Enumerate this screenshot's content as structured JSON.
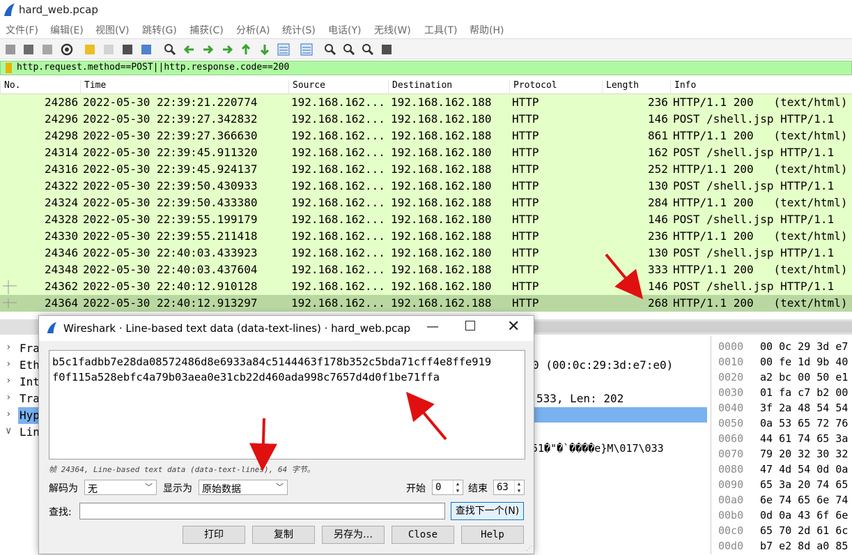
{
  "window": {
    "title": "hard_web.pcap"
  },
  "menu": [
    "文件(F)",
    "编辑(E)",
    "视图(V)",
    "跳转(G)",
    "捕获(C)",
    "分析(A)",
    "统计(S)",
    "电话(Y)",
    "无线(W)",
    "工具(T)",
    "帮助(H)"
  ],
  "toolbar_icons": [
    "start-capture-icon",
    "stop-capture-icon",
    "restart-capture-icon",
    "options-icon",
    "open-file-icon",
    "file-icon",
    "close-file-icon",
    "reload-icon",
    "find-packet-icon",
    "go-back-icon",
    "go-forward-icon",
    "go-to-packet-icon",
    "first-packet-icon",
    "last-packet-icon",
    "autoscroll-icon",
    "colorize-icon",
    "zoom-in-icon",
    "zoom-out-icon",
    "normal-size-icon",
    "resize-columns-icon"
  ],
  "filter": {
    "text": "http.request.method==POST||http.response.code==200"
  },
  "columns": [
    "No.",
    "Time",
    "Source",
    "Destination",
    "Protocol",
    "Length",
    "Info"
  ],
  "packets": [
    {
      "no": "24286",
      "time": "2022-05-30 22:39:21.220774",
      "src": "192.168.162...",
      "dst": "192.168.162.188",
      "proto": "HTTP",
      "len": "236",
      "info": "HTTP/1.1 200   (text/html)"
    },
    {
      "no": "24296",
      "time": "2022-05-30 22:39:27.342832",
      "src": "192.168.162...",
      "dst": "192.168.162.180",
      "proto": "HTTP",
      "len": "146",
      "info": "POST /shell.jsp HTTP/1.1"
    },
    {
      "no": "24298",
      "time": "2022-05-30 22:39:27.366630",
      "src": "192.168.162...",
      "dst": "192.168.162.188",
      "proto": "HTTP",
      "len": "861",
      "info": "HTTP/1.1 200   (text/html)"
    },
    {
      "no": "24314",
      "time": "2022-05-30 22:39:45.911320",
      "src": "192.168.162...",
      "dst": "192.168.162.180",
      "proto": "HTTP",
      "len": "162",
      "info": "POST /shell.jsp HTTP/1.1"
    },
    {
      "no": "24316",
      "time": "2022-05-30 22:39:45.924137",
      "src": "192.168.162...",
      "dst": "192.168.162.188",
      "proto": "HTTP",
      "len": "252",
      "info": "HTTP/1.1 200   (text/html)"
    },
    {
      "no": "24322",
      "time": "2022-05-30 22:39:50.430933",
      "src": "192.168.162...",
      "dst": "192.168.162.180",
      "proto": "HTTP",
      "len": "130",
      "info": "POST /shell.jsp HTTP/1.1"
    },
    {
      "no": "24324",
      "time": "2022-05-30 22:39:50.433380",
      "src": "192.168.162...",
      "dst": "192.168.162.188",
      "proto": "HTTP",
      "len": "284",
      "info": "HTTP/1.1 200   (text/html)"
    },
    {
      "no": "24328",
      "time": "2022-05-30 22:39:55.199179",
      "src": "192.168.162...",
      "dst": "192.168.162.180",
      "proto": "HTTP",
      "len": "146",
      "info": "POST /shell.jsp HTTP/1.1"
    },
    {
      "no": "24330",
      "time": "2022-05-30 22:39:55.211418",
      "src": "192.168.162...",
      "dst": "192.168.162.188",
      "proto": "HTTP",
      "len": "236",
      "info": "HTTP/1.1 200   (text/html)"
    },
    {
      "no": "24346",
      "time": "2022-05-30 22:40:03.433923",
      "src": "192.168.162...",
      "dst": "192.168.162.180",
      "proto": "HTTP",
      "len": "130",
      "info": "POST /shell.jsp HTTP/1.1"
    },
    {
      "no": "24348",
      "time": "2022-05-30 22:40:03.437604",
      "src": "192.168.162...",
      "dst": "192.168.162.188",
      "proto": "HTTP",
      "len": "333",
      "info": "HTTP/1.1 200   (text/html)"
    },
    {
      "no": "24362",
      "time": "2022-05-30 22:40:12.910128",
      "src": "192.168.162...",
      "dst": "192.168.162.180",
      "proto": "HTTP",
      "len": "146",
      "info": "POST /shell.jsp HTTP/1.1"
    },
    {
      "no": "24364",
      "time": "2022-05-30 22:40:12.913297",
      "src": "192.168.162...",
      "dst": "192.168.162.188",
      "proto": "HTTP",
      "len": "268",
      "info": "HTTP/1.1 200   (text/html)"
    }
  ],
  "detail": [
    {
      "text": "Fra",
      "expanded": false
    },
    {
      "text": "Eth",
      "expanded": false
    },
    {
      "text": "Int",
      "expanded": false
    },
    {
      "text": "Tra",
      "expanded": false
    },
    {
      "text": "Hyp",
      "expanded": false,
      "selected": true
    },
    {
      "text": "Lin",
      "expanded": true
    }
  ],
  "detail_visible": {
    "eth_tail": "0 (00:0c:29:3d:e7:e0)",
    "tcp_tail": "533, Len: 202",
    "line_tail": "51�\"�`����e}M\\017\\033"
  },
  "hex": [
    {
      "off": "0000",
      "bytes": "00 0c 29 3d e7"
    },
    {
      "off": "0010",
      "bytes": "00 fe 1d 9b 40"
    },
    {
      "off": "0020",
      "bytes": "a2 bc 00 50 e1"
    },
    {
      "off": "0030",
      "bytes": "01 fa c7 b2 00"
    },
    {
      "off": "0040",
      "bytes": "3f 2a 48 54 54"
    },
    {
      "off": "0050",
      "bytes": "0a 53 65 72 76"
    },
    {
      "off": "0060",
      "bytes": "44 61 74 65 3a"
    },
    {
      "off": "0070",
      "bytes": "79 20 32 30 32"
    },
    {
      "off": "0080",
      "bytes": "47 4d 54 0d 0a"
    },
    {
      "off": "0090",
      "bytes": "65 3a 20 74 65"
    },
    {
      "off": "00a0",
      "bytes": "6e 74 65 6e 74"
    },
    {
      "off": "00b0",
      "bytes": "0d 0a 43 6f 6e"
    },
    {
      "off": "00c0",
      "bytes": "65 70 2d 61 6c"
    },
    {
      "off": "00d0",
      "bytes": "b7 e2 8d a0 85"
    }
  ],
  "dialog": {
    "title": "Wireshark · Line-based text data (data-text-lines) · hard_web.pcap",
    "text_line1": "b5c1fadbb7e28da08572486d8e6933a84c5144463f178b352c5bda71cff4e8ffe919",
    "text_line2": "f0f115a528ebfc4a79b03aea0e31cb22d460ada998c7657d4d0f1be71ffa",
    "status": "帧 24364, Line-based text data (data-text-lines), 64 字节。",
    "decode_label": "解码为",
    "decode_value": "无",
    "show_label": "显示为",
    "show_value": "原始数据",
    "start_label": "开始",
    "start_value": "0",
    "end_label": "结束",
    "end_value": "63",
    "find_label": "查找:",
    "find_value": "",
    "find_next": "查找下一个(N)",
    "buttons": {
      "print": "打印",
      "copy": "复制",
      "save_as": "另存为…",
      "close": "Close",
      "help": "Help"
    }
  },
  "colors": {
    "packet_bg": "#e4ffc7",
    "selected_row": "#b9d7a0",
    "filter_bg": "#aff9a2",
    "arrow": "#e01010",
    "detail_selected": "#7ab2f0"
  }
}
